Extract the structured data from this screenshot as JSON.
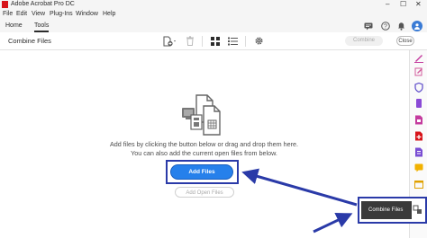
{
  "app": {
    "window_title": "Adobe Acrobat Pro DC"
  },
  "menu": [
    "File",
    "Edit",
    "View",
    "Plug-Ins",
    "Window",
    "Help"
  ],
  "nav": {
    "tabs": [
      "Home",
      "Tools"
    ],
    "active_tab": "Tools"
  },
  "toolbar": {
    "label": "Combine Files",
    "combine_label": "Combine",
    "close_label": "Close"
  },
  "main": {
    "instruction_line1": "Add files by clicking the button below or drag and drop them here.",
    "instruction_line2": "You can also add the current open files from below.",
    "add_files_label": "Add Files",
    "add_open_files_label": "Add Open Files"
  },
  "tooltip": {
    "label": "Combine Files"
  },
  "colors": {
    "accent_blue": "#2680eb",
    "highlight_border": "#2a3aa8",
    "acrobat_red": "#d7141a"
  }
}
